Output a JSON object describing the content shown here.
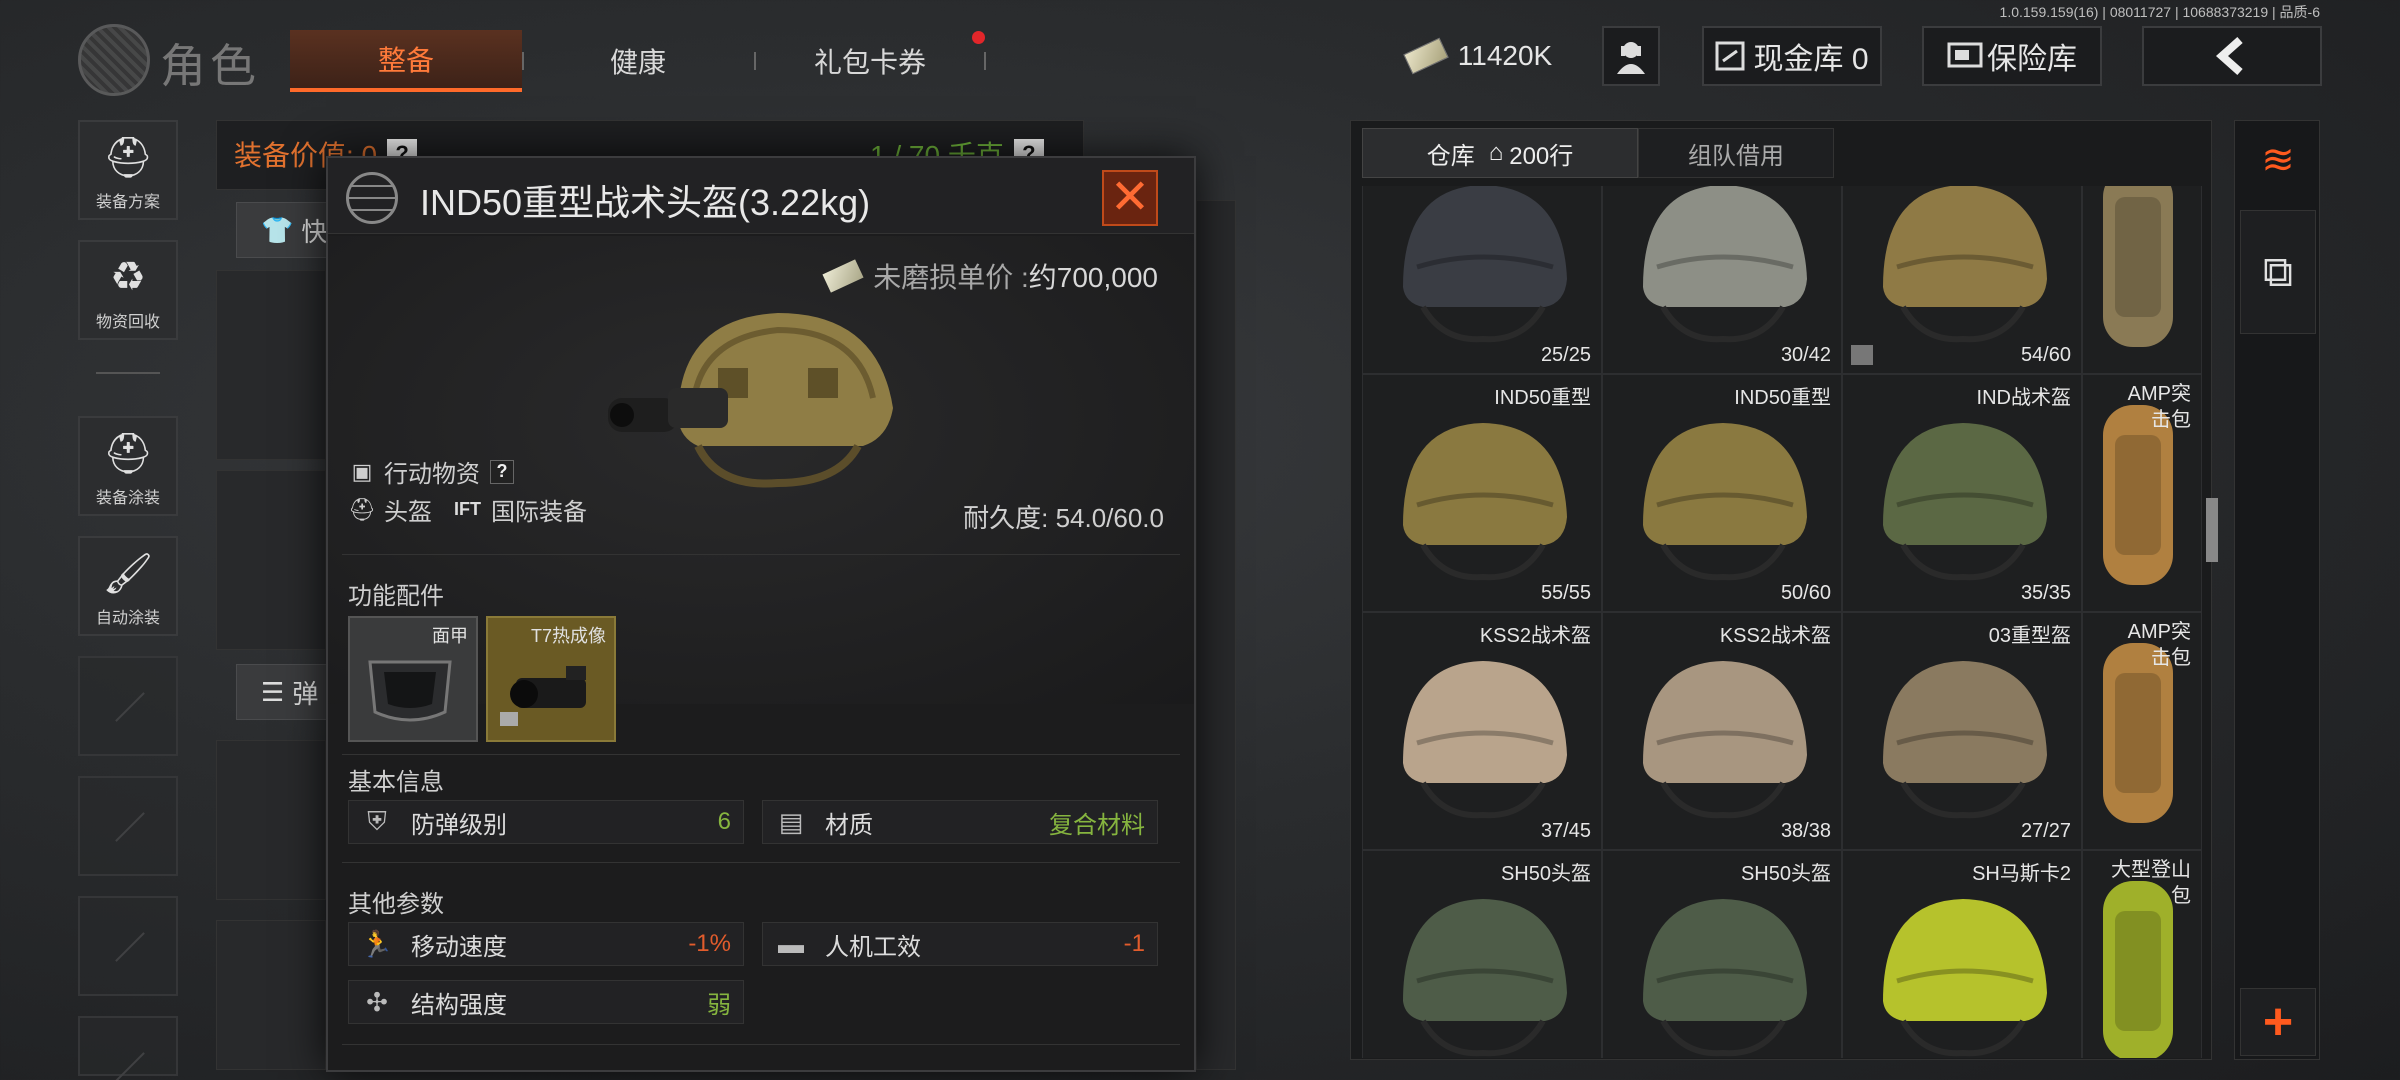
{
  "version": "1.0.159.159(16) | 08011727 | 10688373219 | 品质-6",
  "header": {
    "title": "角色",
    "tabs": [
      {
        "label": "整备",
        "active": true
      },
      {
        "label": "健康",
        "active": false
      },
      {
        "label": "礼包卡券",
        "active": false,
        "has_notification": true
      }
    ],
    "money": "11420K",
    "cash_vault": "现金库 0",
    "insurance_vault": "保险库"
  },
  "sidebar": {
    "items": [
      {
        "label": "装备方案",
        "icon": "loadout-plan-icon"
      },
      {
        "label": "物资回收",
        "icon": "recycle-icon"
      },
      {
        "label": "装备涂装",
        "icon": "paint-icon"
      },
      {
        "label": "自动涂装",
        "icon": "auto-paint-icon"
      }
    ]
  },
  "equipment": {
    "value_label": "装备价值: 0",
    "weight_label": "1 / 70 千克",
    "quick_label": "快",
    "ammo_label": "弹"
  },
  "item_popup": {
    "title": "IND50重型战术头盔(3.22kg)",
    "price_label": "未磨损单价 :",
    "price_value": "约700,000",
    "category": "行动物资",
    "type": "头盔",
    "origin": "国际装备",
    "origin_badge": "IFT",
    "durability_label": "耐久度:",
    "durability_value": "54.0/60.0",
    "attachments_title": "功能配件",
    "attachments": [
      {
        "label": "面甲"
      },
      {
        "label": "T7热成像"
      }
    ],
    "basic_info_title": "基本信息",
    "basic_info": [
      {
        "label": "防弹级别",
        "value": "6",
        "icon": "shield-icon"
      },
      {
        "label": "材质",
        "value": "复合材料",
        "icon": "material-icon"
      }
    ],
    "other_params_title": "其他参数",
    "other_params": [
      {
        "label": "移动速度",
        "value": "-1%",
        "icon": "running-icon"
      },
      {
        "label": "人机工效",
        "value": "-1",
        "icon": "pistol-icon"
      },
      {
        "label": "结构强度",
        "value": "弱",
        "icon": "structure-icon"
      }
    ]
  },
  "warehouse": {
    "tabs": [
      {
        "label": "仓库",
        "rows": "200行",
        "active": true
      },
      {
        "label": "组队借用",
        "active": false
      }
    ],
    "items": [
      {
        "name": "",
        "count": "25/25",
        "color": "#3a3d44"
      },
      {
        "name": "",
        "count": "30/42",
        "color": "#8d8f86"
      },
      {
        "name": "",
        "count": "54/60",
        "color": "#8f7a45"
      },
      {
        "name": "",
        "count": "",
        "color": "#8a7a55"
      },
      {
        "name": "IND50重型",
        "count": "55/55",
        "color": "#8a7940"
      },
      {
        "name": "IND50重型",
        "count": "50/60",
        "color": "#8a7940"
      },
      {
        "name": "IND战术盔",
        "count": "35/35",
        "color": "#5b6844"
      },
      {
        "name": "AMP突击包",
        "count": "",
        "color": "#b08040"
      },
      {
        "name": "KSS2战术盔",
        "count": "37/45",
        "color": "#b9a48c"
      },
      {
        "name": "KSS2战术盔",
        "count": "38/38",
        "color": "#a89680"
      },
      {
        "name": "03重型盔",
        "count": "27/27",
        "color": "#8a7a60"
      },
      {
        "name": "AMP突击包",
        "count": "",
        "color": "#b08040"
      },
      {
        "name": "SH50头盔",
        "count": "",
        "color": "#4e5c48"
      },
      {
        "name": "SH50头盔",
        "count": "",
        "color": "#4e5c48"
      },
      {
        "name": "SH马斯卡2",
        "count": "",
        "color": "#b6c22c"
      },
      {
        "name": "大型登山包",
        "count": "",
        "color": "#9fb02a"
      }
    ]
  },
  "colors": {
    "accent": "#ff6a2a",
    "positive": "#86b53f",
    "negative": "#e25c2c"
  }
}
